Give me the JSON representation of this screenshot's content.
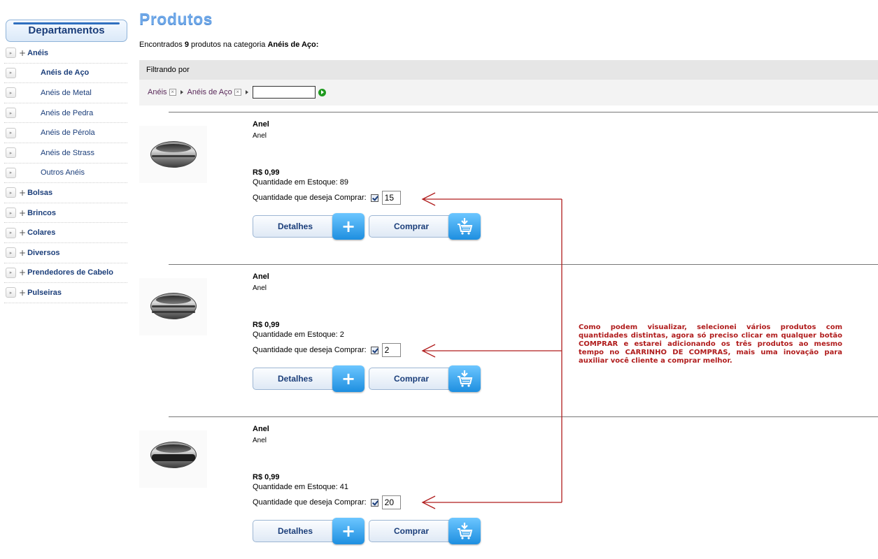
{
  "sidebar": {
    "header": "Departamentos",
    "items": [
      {
        "label": "Anéis",
        "type": "category"
      },
      {
        "label": "Anéis de Aço",
        "type": "sub",
        "active": true
      },
      {
        "label": "Anéis de Metal",
        "type": "sub"
      },
      {
        "label": "Anéis de Pedra",
        "type": "sub"
      },
      {
        "label": "Anéis de Pérola",
        "type": "sub"
      },
      {
        "label": "Anéis de Strass",
        "type": "sub"
      },
      {
        "label": "Outros Anéis",
        "type": "sub"
      },
      {
        "label": "Bolsas",
        "type": "category"
      },
      {
        "label": "Brincos",
        "type": "category"
      },
      {
        "label": "Colares",
        "type": "category"
      },
      {
        "label": "Diversos",
        "type": "category"
      },
      {
        "label": "Prendedores de Cabelo",
        "type": "category"
      },
      {
        "label": "Pulseiras",
        "type": "category"
      }
    ]
  },
  "main": {
    "title": "Produtos",
    "found": {
      "prefix": "Encontrados ",
      "count": "9",
      "middle": " produtos na categoria ",
      "category": "Anéis de Aço:"
    },
    "filter": {
      "label": "Filtrando por",
      "crumbs": [
        "Anéis",
        "Anéis de Aço"
      ],
      "input_value": ""
    }
  },
  "products": [
    {
      "name": "Anel",
      "desc": "Anel",
      "price": "R$ 0,99",
      "stock": "Quantidade em Estoque: 89",
      "qty_label": "Quantidade que deseja Comprar:",
      "qty": "15",
      "details": "Detalhes",
      "buy": "Comprar"
    },
    {
      "name": "Anel",
      "desc": "Anel",
      "price": "R$ 0,99",
      "stock": "Quantidade em Estoque: 2",
      "qty_label": "Quantidade que deseja Comprar:",
      "qty": "2",
      "details": "Detalhes",
      "buy": "Comprar"
    },
    {
      "name": "Anel",
      "desc": "Anel",
      "price": "R$ 0,99",
      "stock": "Quantidade em Estoque: 41",
      "qty_label": "Quantidade que deseja Comprar:",
      "qty": "20",
      "details": "Detalhes",
      "buy": "Comprar"
    }
  ],
  "annotation": {
    "text": "Como podem visualizar, selecionei vários produtos com quantidades distintas, agora só preciso clicar em qualquer botão COMPRAR e estarei adicionando os três produtos ao mesmo tempo no CARRINHO DE COMPRAS, mais uma inovação para auxiliar você cliente a comprar melhor.",
    "color": "#b01c1c"
  },
  "colors": {
    "accent": "#1b3e7a",
    "title": "#6fa8e8",
    "button_icon": "#1e8fe0"
  }
}
